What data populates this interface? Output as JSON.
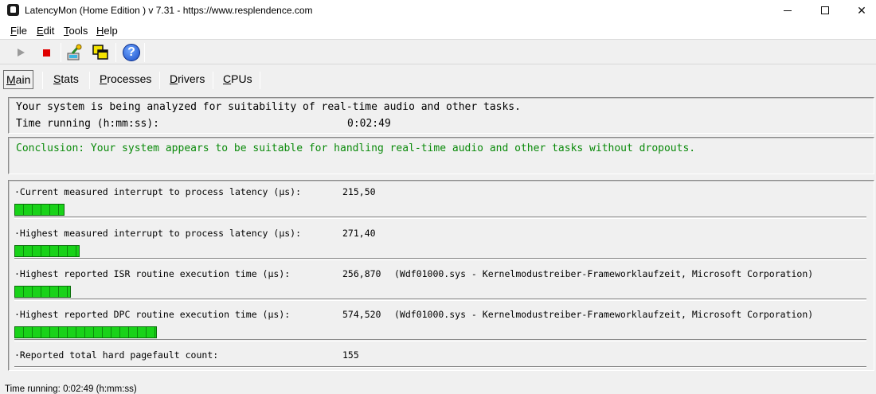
{
  "window": {
    "title": "LatencyMon  (Home Edition )  v 7.31 - https://www.resplendence.com",
    "minimize": "–",
    "maximize": "□",
    "close": "✕"
  },
  "menu": [
    {
      "key": "F",
      "rest": "ile"
    },
    {
      "key": "E",
      "rest": "dit"
    },
    {
      "key": "T",
      "rest": "ools"
    },
    {
      "key": "H",
      "rest": "elp"
    }
  ],
  "toolbar": {
    "icons": [
      "play-icon",
      "stop-icon",
      "processes-icon",
      "windows-icon",
      "help-icon"
    ],
    "help_glyph": "?"
  },
  "tabs": [
    {
      "key": "M",
      "rest": "ain",
      "active": true
    },
    {
      "key": "S",
      "rest": "tats"
    },
    {
      "key": "P",
      "rest": "rocesses"
    },
    {
      "key": "D",
      "rest": "rivers"
    },
    {
      "key": "C",
      "rest": "PUs"
    }
  ],
  "status_panel": {
    "analysis_text": "Your system is being analyzed for suitability of real-time audio and other tasks.",
    "time_label": "Time running (h:mm:ss):",
    "time_value": "0:02:49"
  },
  "conclusion": "Conclusion: Your system appears to be suitable for handling real-time audio and other tasks without dropouts.",
  "colors": {
    "conclusion": "#0a8a0a",
    "bar": "#19d219",
    "stop": "#e00000"
  },
  "metrics": [
    {
      "label": "·Current measured interrupt to process latency (µs):",
      "value": "215,50",
      "driver": "",
      "bar_fraction": 0.059
    },
    {
      "label": "·Highest measured interrupt to process latency (µs):",
      "value": "271,40",
      "driver": "",
      "bar_fraction": 0.077
    },
    {
      "label": "·Highest reported ISR routine execution time (µs):",
      "value": "256,870",
      "driver": "(Wdf01000.sys - Kernelmodustreiber-Frameworklaufzeit, Microsoft Corporation)",
      "bar_fraction": 0.066
    },
    {
      "label": "·Highest reported DPC routine execution time (µs):",
      "value": "574,520",
      "driver": "(Wdf01000.sys - Kernelmodustreiber-Frameworklaufzeit, Microsoft Corporation)",
      "bar_fraction": 0.167
    },
    {
      "label": "·Reported total hard pagefault count:",
      "value": "155",
      "driver": "",
      "bar_fraction": null
    }
  ],
  "statusbar": "Time running: 0:02:49  (h:mm:ss)"
}
